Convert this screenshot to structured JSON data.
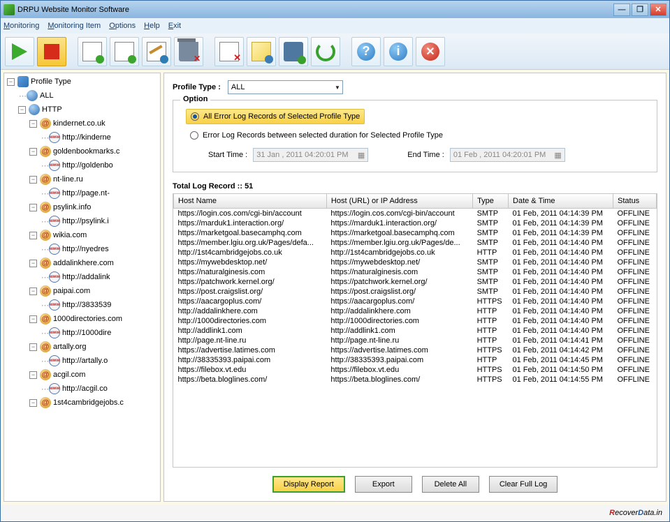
{
  "window": {
    "title": "DRPU Website Monitor Software"
  },
  "menu": [
    "Monitoring",
    "Monitoring Item",
    "Options",
    "Help",
    "Exit"
  ],
  "tree": {
    "root": "Profile Type",
    "all": "ALL",
    "http": "HTTP",
    "sites": [
      {
        "domain": "kindernet.co.uk",
        "url": "http://kinderne"
      },
      {
        "domain": "goldenbookmarks.c",
        "url": "http://goldenbo"
      },
      {
        "domain": "nt-line.ru",
        "url": "http://page.nt-"
      },
      {
        "domain": "psylink.info",
        "url": "http://psylink.i"
      },
      {
        "domain": "wikia.com",
        "url": "http://nyedres"
      },
      {
        "domain": "addalinkhere.com",
        "url": "http://addalink"
      },
      {
        "domain": "paipai.com",
        "url": "http://3833539"
      },
      {
        "domain": "1000directories.com",
        "url": "http://1000dire"
      },
      {
        "domain": "artally.org",
        "url": "http://artally.o"
      },
      {
        "domain": "acgil.com",
        "url": "http://acgil.co"
      },
      {
        "domain": "1st4cambridgejobs.c",
        "url": ""
      }
    ]
  },
  "profile": {
    "label": "Profile Type :",
    "value": "ALL"
  },
  "option": {
    "legend": "Option",
    "opt1": "All Error Log Records of Selected Profile Type",
    "opt2": "Error Log Records between selected duration for Selected Profile Type",
    "start_label": "Start Time :",
    "start_value": "31 Jan , 2011 04:20:01 PM",
    "end_label": "End Time :",
    "end_value": "01 Feb , 2011 04:20:01 PM"
  },
  "total_label": "Total Log Record :: 51",
  "columns": [
    "Host Name",
    "Host (URL) or IP Address",
    "Type",
    "Date & Time",
    "Status"
  ],
  "rows": [
    [
      "https://login.cos.com/cgi-bin/account",
      "https://login.cos.com/cgi-bin/account",
      "SMTP",
      "01 Feb, 2011 04:14:39 PM",
      "OFFLINE"
    ],
    [
      "https://marduk1.interaction.org/",
      "https://marduk1.interaction.org/",
      "SMTP",
      "01 Feb, 2011 04:14:39 PM",
      "OFFLINE"
    ],
    [
      "https://marketgoal.basecamphq.com",
      "https://marketgoal.basecamphq.com",
      "SMTP",
      "01 Feb, 2011 04:14:39 PM",
      "OFFLINE"
    ],
    [
      "https://member.lgiu.org.uk/Pages/defa...",
      "https://member.lgiu.org.uk/Pages/de...",
      "SMTP",
      "01 Feb, 2011 04:14:40 PM",
      "OFFLINE"
    ],
    [
      "http://1st4cambridgejobs.co.uk",
      "http://1st4cambridgejobs.co.uk",
      "HTTP",
      "01 Feb, 2011 04:14:40 PM",
      "OFFLINE"
    ],
    [
      "https://mywebdesktop.net/",
      "https://mywebdesktop.net/",
      "SMTP",
      "01 Feb, 2011 04:14:40 PM",
      "OFFLINE"
    ],
    [
      "https://naturalginesis.com",
      "https://naturalginesis.com",
      "SMTP",
      "01 Feb, 2011 04:14:40 PM",
      "OFFLINE"
    ],
    [
      "https://patchwork.kernel.org/",
      "https://patchwork.kernel.org/",
      "SMTP",
      "01 Feb, 2011 04:14:40 PM",
      "OFFLINE"
    ],
    [
      "https://post.craigslist.org/",
      "https://post.craigslist.org/",
      "SMTP",
      "01 Feb, 2011 04:14:40 PM",
      "OFFLINE"
    ],
    [
      "https://aacargoplus.com/",
      "https://aacargoplus.com/",
      "HTTPS",
      "01 Feb, 2011 04:14:40 PM",
      "OFFLINE"
    ],
    [
      "http://addalinkhere.com",
      "http://addalinkhere.com",
      "HTTP",
      "01 Feb, 2011 04:14:40 PM",
      "OFFLINE"
    ],
    [
      "http://1000directories.com",
      "http://1000directories.com",
      "HTTP",
      "01 Feb, 2011 04:14:40 PM",
      "OFFLINE"
    ],
    [
      "http://addlink1.com",
      "http://addlink1.com",
      "HTTP",
      "01 Feb, 2011 04:14:40 PM",
      "OFFLINE"
    ],
    [
      "http://page.nt-line.ru",
      "http://page.nt-line.ru",
      "HTTP",
      "01 Feb, 2011 04:14:41 PM",
      "OFFLINE"
    ],
    [
      "https://advertise.latimes.com",
      "https://advertise.latimes.com",
      "HTTPS",
      "01 Feb, 2011 04:14:42 PM",
      "OFFLINE"
    ],
    [
      "http://38335393.paipai.com",
      "http://38335393.paipai.com",
      "HTTP",
      "01 Feb, 2011 04:14:45 PM",
      "OFFLINE"
    ],
    [
      "https://filebox.vt.edu",
      "https://filebox.vt.edu",
      "HTTPS",
      "01 Feb, 2011 04:14:50 PM",
      "OFFLINE"
    ],
    [
      "https://beta.bloglines.com/",
      "https://beta.bloglines.com/",
      "HTTPS",
      "01 Feb, 2011 04:14:55 PM",
      "OFFLINE"
    ]
  ],
  "buttons": {
    "display": "Display Report",
    "export": "Export",
    "delete": "Delete All",
    "clear": "Clear Full Log"
  },
  "footer": {
    "r": "R",
    "ecover": "ecover",
    "d": "D",
    "ata": "ata.in"
  }
}
